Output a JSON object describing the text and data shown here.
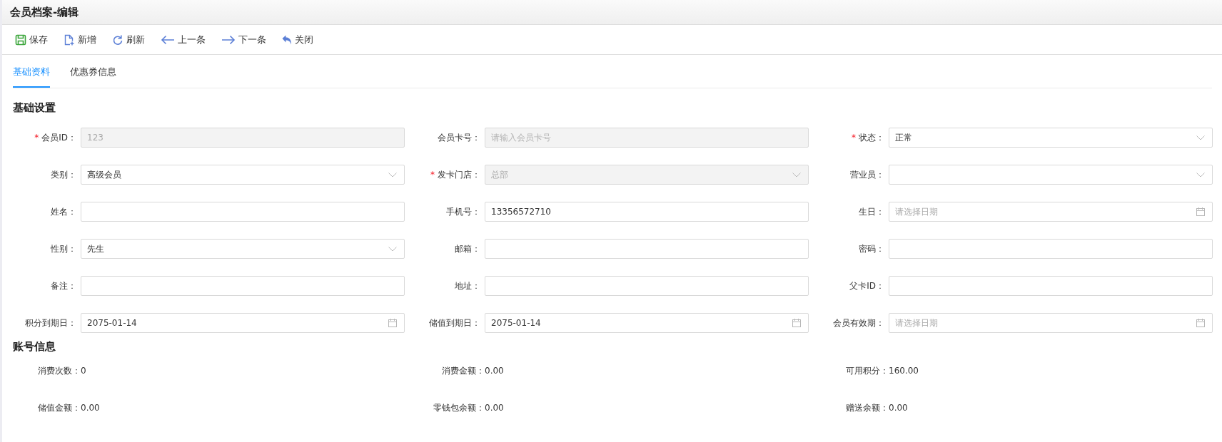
{
  "window": {
    "title": "会员档案-编辑"
  },
  "toolbar": [
    "保存",
    "新增",
    "刷新",
    "上一条",
    "下一条",
    "关闭"
  ],
  "tabs": [
    {
      "label": "基础资料",
      "selected": true
    },
    {
      "label": "优惠券信息",
      "selected": false
    }
  ],
  "basic_section": {
    "title": "基础设置",
    "fields": [
      {
        "label": "会员ID：",
        "required_mark": "*",
        "kind": "text",
        "value": "123",
        "disabled": true
      },
      {
        "label": "会员卡号：",
        "kind": "text",
        "placeholder": "请输入会员卡号",
        "disabled": true
      },
      {
        "label": "状态：",
        "required_mark": "*",
        "kind": "select",
        "value": "正常"
      },
      {
        "label": "类别：",
        "kind": "select",
        "value": "高级会员"
      },
      {
        "label": "发卡门店：",
        "required_mark": "*",
        "kind": "select",
        "value": "总部",
        "disabled": true
      },
      {
        "label": "营业员：",
        "kind": "select"
      },
      {
        "label": "姓名：",
        "kind": "text"
      },
      {
        "label": "手机号：",
        "kind": "text",
        "value": "13356572710"
      },
      {
        "label": "生日：",
        "kind": "date",
        "placeholder": "请选择日期"
      },
      {
        "label": "性别：",
        "kind": "select",
        "value": "先生"
      },
      {
        "label": "邮箱：",
        "kind": "text"
      },
      {
        "label": "密码：",
        "kind": "text"
      },
      {
        "label": "备注：",
        "kind": "text"
      },
      {
        "label": "地址：",
        "kind": "text"
      },
      {
        "label": "父卡ID：",
        "kind": "text"
      },
      {
        "label": "积分到期日：",
        "kind": "date",
        "value": "2075-01-14"
      },
      {
        "label": "储值到期日：",
        "kind": "date",
        "value": "2075-01-14"
      },
      {
        "label": "会员有效期：",
        "kind": "date",
        "placeholder": "请选择日期"
      }
    ]
  },
  "account_section": {
    "title": "账号信息",
    "items": [
      {
        "label": "消费次数：",
        "value": "0"
      },
      {
        "label": "消费金额：",
        "value": "0.00"
      },
      {
        "label": "可用积分：",
        "value": "160.00"
      },
      {
        "label": "储值金额：",
        "value": "0.00"
      },
      {
        "label": "零钱包余额：",
        "value": "0.00"
      },
      {
        "label": "赠送余额：",
        "value": "0.00"
      }
    ]
  }
}
